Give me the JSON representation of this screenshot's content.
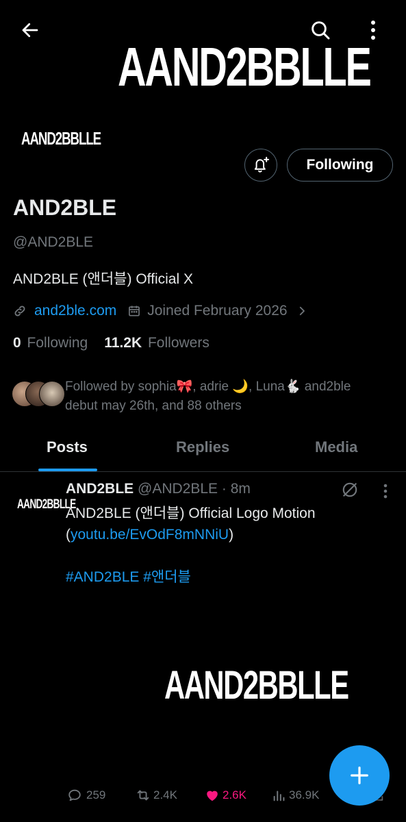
{
  "header": {
    "banner_logo": "AAND2BBLLE",
    "back_icon": "arrow-left-icon",
    "search_icon": "search-icon",
    "more_icon": "more-vertical-icon"
  },
  "profile": {
    "avatar_logo": "AAND2BBLLE",
    "notify_icon": "bell-plus-icon",
    "following_button": "Following",
    "name": "AND2BLE",
    "handle": "@AND2BLE",
    "bio": "AND2BLE (앤더블) Official X",
    "website": "and2ble.com",
    "joined": "Joined February 2026",
    "following_count": "0",
    "following_label": "Following",
    "followers_count": "11.2K",
    "followers_label": "Followers",
    "followed_by_line1": "Followed by sophia🎀, adrie 🌙, Luna🐇 and2ble",
    "followed_by_line2": "debut may 26th, and 88 others"
  },
  "tabs": [
    {
      "label": "Posts"
    },
    {
      "label": "Replies"
    },
    {
      "label": "Media"
    }
  ],
  "post": {
    "author_name": "AND2BLE",
    "author_handle": "@AND2BLE · 8m",
    "avatar_logo": "AAND2BBLLE",
    "text_line1": "AND2BLE (앤더블) Official Logo Motion",
    "text_open_paren": "(",
    "text_link": "youtu.be/EvOdF8mNNiU",
    "text_close_paren": ")",
    "hashtags": "#AND2BLE #앤더블",
    "media_logo": "AAND2BBLLE",
    "replies": "259",
    "reposts": "2.4K",
    "likes": "2.6K",
    "views": "36.9K"
  },
  "colors": {
    "accent": "#1d9bf0",
    "like": "#f91880",
    "muted": "#71767b",
    "background": "#000000"
  }
}
